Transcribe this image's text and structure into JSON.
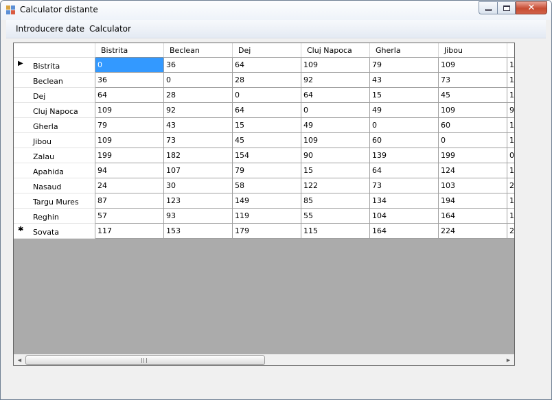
{
  "window": {
    "title": "Calculator distante",
    "close_glyph": "✕",
    "colors": {
      "selection": "#3399ff",
      "grid_background": "#ababab",
      "close_button": "#c74d33"
    }
  },
  "menu": {
    "items": [
      {
        "label": "Introducere date"
      },
      {
        "label": "Calculator"
      }
    ]
  },
  "grid": {
    "columns": [
      "Bistrita",
      "Beclean",
      "Dej",
      "Cluj Napoca",
      "Gherla",
      "Jibou",
      ""
    ],
    "rows": [
      {
        "label": "Bistrita",
        "indicator": "▶",
        "cells": [
          "0",
          "36",
          "64",
          "109",
          "79",
          "109",
          "1"
        ]
      },
      {
        "label": "Beclean",
        "indicator": "",
        "cells": [
          "36",
          "0",
          "28",
          "92",
          "43",
          "73",
          "1"
        ]
      },
      {
        "label": "Dej",
        "indicator": "",
        "cells": [
          "64",
          "28",
          "0",
          "64",
          "15",
          "45",
          "1"
        ]
      },
      {
        "label": "Cluj Napoca",
        "indicator": "",
        "cells": [
          "109",
          "92",
          "64",
          "0",
          "49",
          "109",
          "9"
        ]
      },
      {
        "label": "Gherla",
        "indicator": "",
        "cells": [
          "79",
          "43",
          "15",
          "49",
          "0",
          "60",
          "1"
        ]
      },
      {
        "label": "Jibou",
        "indicator": "",
        "cells": [
          "109",
          "73",
          "45",
          "109",
          "60",
          "0",
          "1"
        ]
      },
      {
        "label": "Zalau",
        "indicator": "",
        "cells": [
          "199",
          "182",
          "154",
          "90",
          "139",
          "199",
          "0"
        ]
      },
      {
        "label": "Apahida",
        "indicator": "",
        "cells": [
          "94",
          "107",
          "79",
          "15",
          "64",
          "124",
          "1"
        ]
      },
      {
        "label": "Nasaud",
        "indicator": "",
        "cells": [
          "24",
          "30",
          "58",
          "122",
          "73",
          "103",
          "2"
        ]
      },
      {
        "label": "Targu Mures",
        "indicator": "",
        "cells": [
          "87",
          "123",
          "149",
          "85",
          "134",
          "194",
          "1"
        ]
      },
      {
        "label": "Reghin",
        "indicator": "",
        "cells": [
          "57",
          "93",
          "119",
          "55",
          "104",
          "164",
          "1"
        ]
      },
      {
        "label": "Sovata",
        "indicator": "✱",
        "cells": [
          "117",
          "153",
          "179",
          "115",
          "164",
          "224",
          "2"
        ]
      }
    ],
    "selected": {
      "row": 0,
      "col": 0
    }
  },
  "scrollbar": {
    "left_arrow": "◀",
    "right_arrow": "▶"
  }
}
